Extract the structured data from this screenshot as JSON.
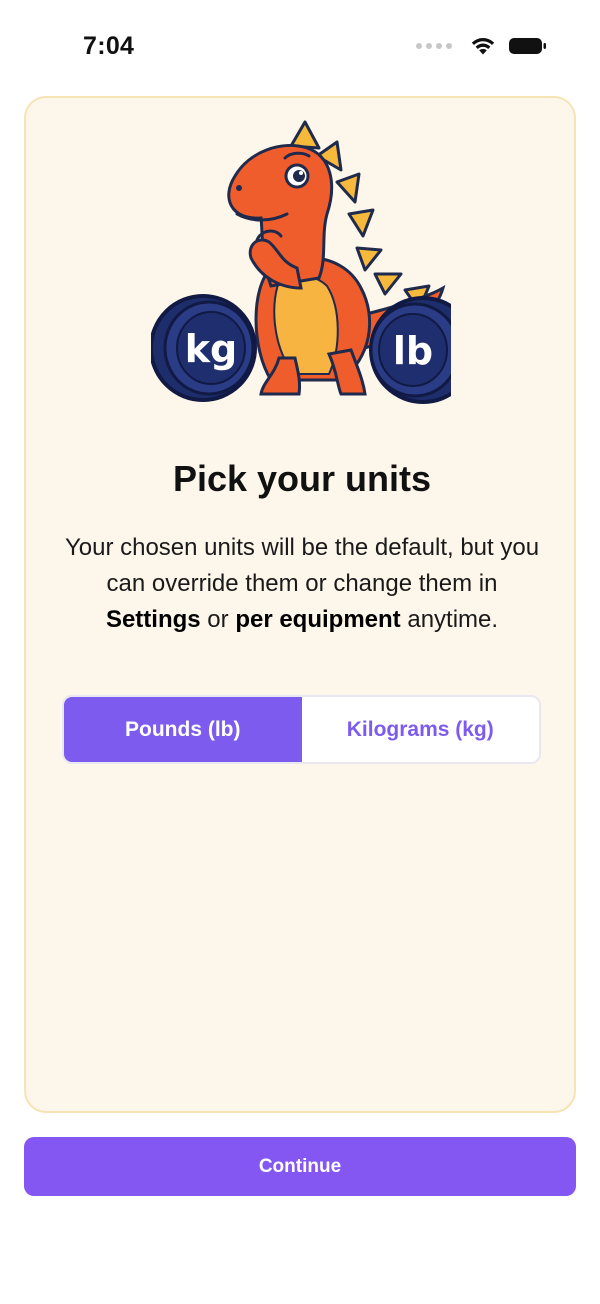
{
  "status_bar": {
    "time": "7:04",
    "icons": [
      "signal-icon",
      "wifi-icon",
      "battery-icon"
    ]
  },
  "card": {
    "illustration": {
      "icon": "dinosaur-mascot-icon",
      "left_plate_label": "kg",
      "right_plate_label": "lb"
    },
    "title": "Pick your units",
    "description": {
      "part1": "Your chosen units will be the default, but you can override them or change them in ",
      "settings": "Settings",
      "part2": " or ",
      "per_equipment": "per equipment",
      "part3": " anytime."
    },
    "unit_options": [
      {
        "label": "Pounds (lb)",
        "selected": true
      },
      {
        "label": "Kilograms (kg)",
        "selected": false
      }
    ]
  },
  "continue_label": "Continue",
  "colors": {
    "accent": "#7e5bef",
    "card_background": "#fdf6ea",
    "card_border": "#f8e3b4"
  }
}
